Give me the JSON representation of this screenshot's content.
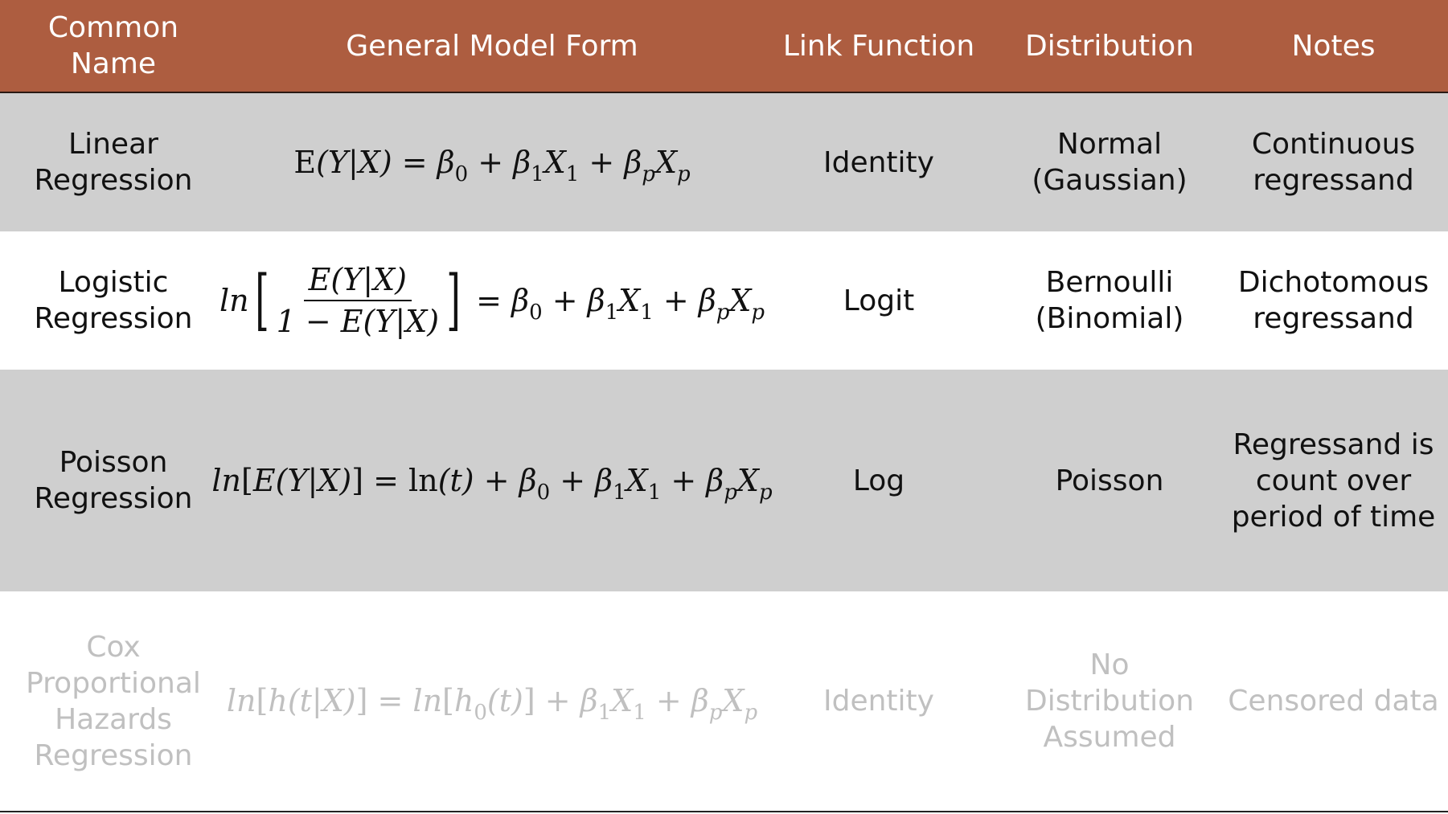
{
  "headers": {
    "common_name": "Common\nName",
    "general_model_form": "General Model Form",
    "link_function": "Link Function",
    "distribution": "Distribution",
    "notes": "Notes"
  },
  "rows": [
    {
      "name": "Linear\nRegression",
      "formula": "E(Y|X) = β0 + β1X1 + βpXp",
      "link": "Identity",
      "distribution": "Normal\n(Gaussian)",
      "notes": "Continuous\nregressand"
    },
    {
      "name": "Logistic\nRegression",
      "formula": "ln[E(Y|X) / (1 − E(Y|X))] = β0 + β1X1 + βpXp",
      "formula_parts": {
        "prefix": "ln",
        "numerator": "E(Y|X)",
        "denominator": "1 − E(Y|X)"
      },
      "link": "Logit",
      "distribution": "Bernoulli\n(Binomial)",
      "notes": "Dichotomous\nregressand"
    },
    {
      "name": "Poisson\nRegression",
      "formula": "ln[E(Y|X)] = ln(t) + β0 + β1X1 + βpXp",
      "link": "Log",
      "distribution": "Poisson",
      "notes": "Regressand is\ncount over\nperiod of time"
    },
    {
      "name": "Cox\nProportional\nHazards\nRegression",
      "formula": "ln[h(t|X)] = ln[h0(t)] + β1X1 + βpXp",
      "link": "Identity",
      "distribution": "No\nDistribution\nAssumed",
      "notes": "Censored data"
    }
  ],
  "colors": {
    "header_bg": "#ad5d40",
    "header_text": "#ffffff",
    "shaded_row_bg": "#cfcfcf",
    "dimmed_text": "#c0c0c0"
  }
}
